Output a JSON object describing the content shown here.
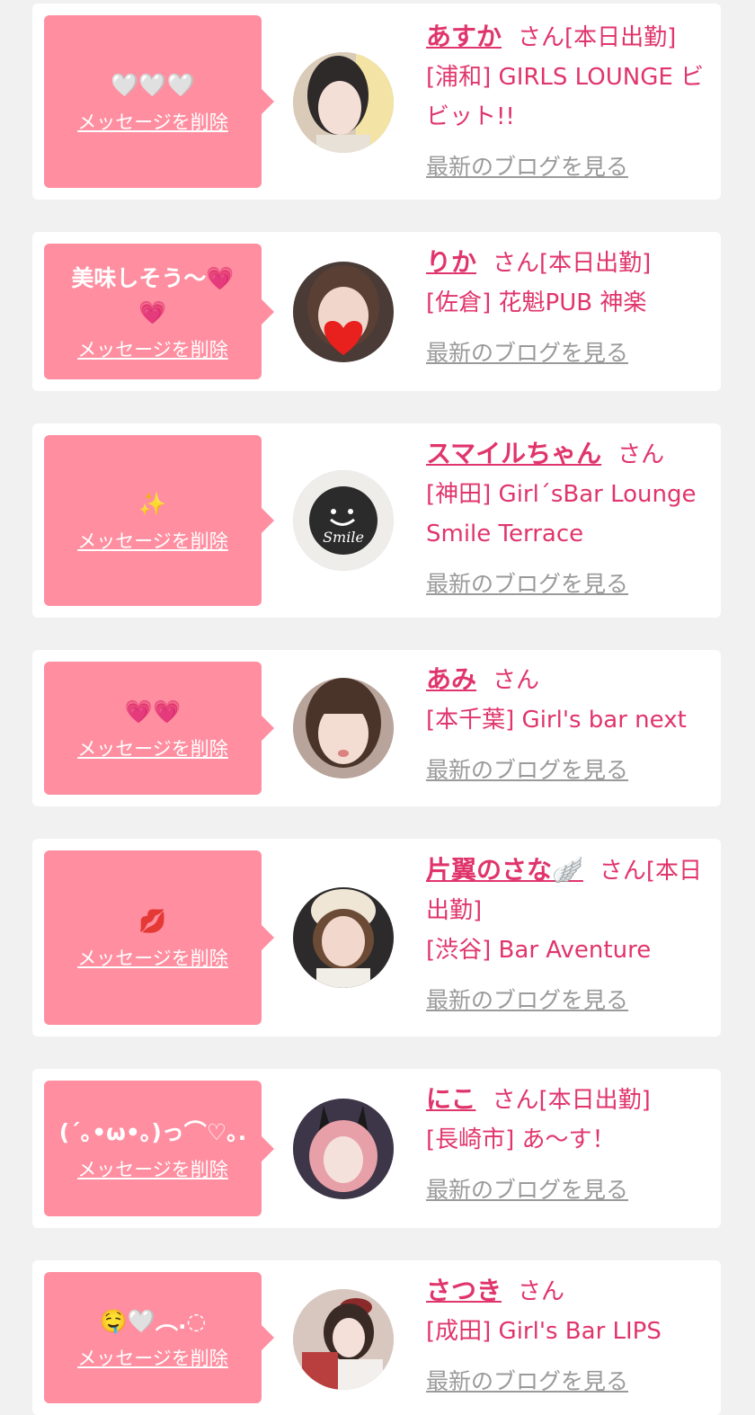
{
  "colors": {
    "bubble": "#ff8ea0",
    "accent": "#e0356c",
    "link_gray": "#9a9a9a",
    "page_bg": "#f1f1f1"
  },
  "entries": [
    {
      "message": "🤍🤍🤍",
      "delete_label": "メッセージを削除",
      "name": "あすか",
      "honorific": "さん",
      "status": "[本日出勤]",
      "shop": "[浦和] GIRLS LOUNGE ビビット!!",
      "blog_link": "最新のブログを見る"
    },
    {
      "message": "美味しそう〜💗💗",
      "delete_label": "メッセージを削除",
      "name": "りか",
      "honorific": "さん",
      "status": "[本日出勤]",
      "shop": "[佐倉] 花魁PUB 神楽",
      "blog_link": "最新のブログを見る"
    },
    {
      "message": "✨",
      "delete_label": "メッセージを削除",
      "name": "スマイルちゃん",
      "honorific": "さん",
      "status": "",
      "shop": "[神田] Girl´sBar Lounge Smile Terrace",
      "blog_link": "最新のブログを見る",
      "avatar_text": "Smile"
    },
    {
      "message": "💗💗",
      "delete_label": "メッセージを削除",
      "name": "あみ",
      "honorific": "さん",
      "status": "",
      "shop": "[本千葉] Girl's bar next",
      "blog_link": "最新のブログを見る"
    },
    {
      "message": "💋",
      "delete_label": "メッセージを削除",
      "name": "片翼のさな🪽",
      "honorific": "さん",
      "status": "[本日出勤]",
      "shop": "[渋谷] Bar Aventure",
      "blog_link": "最新のブログを見る"
    },
    {
      "message": "(´｡•ω•｡)っ⌒♡｡.",
      "delete_label": "メッセージを削除",
      "name": "にこ",
      "honorific": "さん",
      "status": "[本日出勤]",
      "shop": "[長崎市] あ〜す！",
      "blog_link": "最新のブログを見る"
    },
    {
      "message": "🤤🤍︵.◌",
      "delete_label": "メッセージを削除",
      "name": "さつき",
      "honorific": "さん",
      "status": "",
      "shop": "[成田] Girl's Bar LIPS",
      "blog_link": "最新のブログを見る"
    }
  ]
}
